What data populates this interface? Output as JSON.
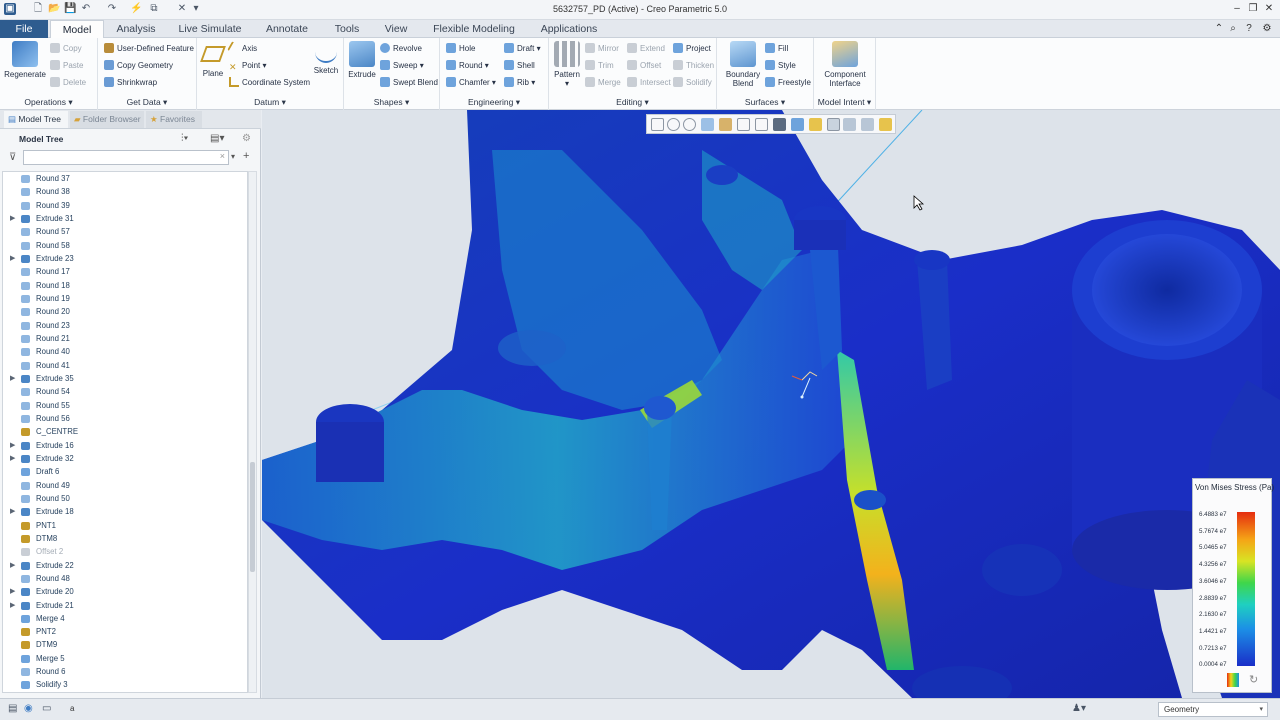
{
  "window": {
    "title": "5632757_PD (Active) - Creo Parametric 5.0"
  },
  "menu_tabs": [
    "File",
    "Model",
    "Analysis",
    "Live Simulate",
    "Annotate",
    "Tools",
    "View",
    "Flexible Modeling",
    "Applications"
  ],
  "ribbon": {
    "operations": {
      "label": "Operations",
      "regenerate": "Regenerate",
      "copy": "Copy",
      "paste": "Paste",
      "delete": "Delete"
    },
    "get_data": {
      "label": "Get Data",
      "udf": "User-Defined Feature",
      "copy_geometry": "Copy Geometry",
      "shrinkwrap": "Shrinkwrap"
    },
    "datum": {
      "label": "Datum",
      "plane": "Plane",
      "axis": "Axis",
      "point": "Point",
      "coord_sys": "Coordinate System",
      "sketch": "Sketch"
    },
    "shapes": {
      "label": "Shapes",
      "extrude": "Extrude",
      "revolve": "Revolve",
      "sweep": "Sweep",
      "swept_blend": "Swept Blend"
    },
    "engineering": {
      "label": "Engineering",
      "hole": "Hole",
      "round": "Round",
      "chamfer": "Chamfer",
      "draft": "Draft",
      "shell": "Shell",
      "rib": "Rib"
    },
    "editing": {
      "label": "Editing",
      "pattern": "Pattern",
      "mirror": "Mirror",
      "trim": "Trim",
      "merge": "Merge",
      "extend": "Extend",
      "offset": "Offset",
      "intersect": "Intersect",
      "project": "Project",
      "thicken": "Thicken",
      "solidify": "Solidify"
    },
    "surfaces": {
      "label": "Surfaces",
      "boundary_blend": "Boundary Blend",
      "fill": "Fill",
      "style": "Style",
      "freestyle": "Freestyle"
    },
    "model_intent": {
      "label": "Model Intent",
      "component_interface": "Component Interface"
    }
  },
  "nav_tabs": [
    "Model Tree",
    "Folder Browser",
    "Favorites"
  ],
  "model_tree": {
    "title": "Model Tree",
    "items": [
      {
        "label": "Round 37",
        "type": "round",
        "expandable": false,
        "dim": false
      },
      {
        "label": "Round 38",
        "type": "round",
        "expandable": false,
        "dim": false
      },
      {
        "label": "Round 39",
        "type": "round",
        "expandable": false,
        "dim": false
      },
      {
        "label": "Extrude 31",
        "type": "extrude",
        "expandable": true,
        "dim": false
      },
      {
        "label": "Round 57",
        "type": "round",
        "expandable": false,
        "dim": false
      },
      {
        "label": "Round 58",
        "type": "round",
        "expandable": false,
        "dim": false
      },
      {
        "label": "Extrude 23",
        "type": "extrude",
        "expandable": true,
        "dim": false
      },
      {
        "label": "Round 17",
        "type": "round",
        "expandable": false,
        "dim": false
      },
      {
        "label": "Round 18",
        "type": "round",
        "expandable": false,
        "dim": false
      },
      {
        "label": "Round 19",
        "type": "round",
        "expandable": false,
        "dim": false
      },
      {
        "label": "Round 20",
        "type": "round",
        "expandable": false,
        "dim": false
      },
      {
        "label": "Round 23",
        "type": "round",
        "expandable": false,
        "dim": false
      },
      {
        "label": "Round 21",
        "type": "round",
        "expandable": false,
        "dim": false
      },
      {
        "label": "Round 40",
        "type": "round",
        "expandable": false,
        "dim": false
      },
      {
        "label": "Round 41",
        "type": "round",
        "expandable": false,
        "dim": false
      },
      {
        "label": "Extrude 35",
        "type": "extrude",
        "expandable": true,
        "dim": false
      },
      {
        "label": "Round 54",
        "type": "round",
        "expandable": false,
        "dim": false
      },
      {
        "label": "Round 55",
        "type": "round",
        "expandable": false,
        "dim": false
      },
      {
        "label": "Round 56",
        "type": "round",
        "expandable": false,
        "dim": false
      },
      {
        "label": "C_CENTRE",
        "type": "datum",
        "expandable": false,
        "dim": false
      },
      {
        "label": "Extrude 16",
        "type": "extrude",
        "expandable": true,
        "dim": false
      },
      {
        "label": "Extrude 32",
        "type": "extrude",
        "expandable": true,
        "dim": false
      },
      {
        "label": "Draft 6",
        "type": "draft",
        "expandable": false,
        "dim": false
      },
      {
        "label": "Round 49",
        "type": "round",
        "expandable": false,
        "dim": false
      },
      {
        "label": "Round 50",
        "type": "round",
        "expandable": false,
        "dim": false
      },
      {
        "label": "Extrude 18",
        "type": "extrude",
        "expandable": true,
        "dim": false
      },
      {
        "label": "PNT1",
        "type": "point",
        "expandable": false,
        "dim": false
      },
      {
        "label": "DTM8",
        "type": "plane",
        "expandable": false,
        "dim": false
      },
      {
        "label": "Offset 2",
        "type": "offset",
        "expandable": false,
        "dim": true
      },
      {
        "label": "Extrude 22",
        "type": "extrude",
        "expandable": true,
        "dim": false
      },
      {
        "label": "Round 48",
        "type": "round",
        "expandable": false,
        "dim": false
      },
      {
        "label": "Extrude 20",
        "type": "extrude",
        "expandable": true,
        "dim": false
      },
      {
        "label": "Extrude 21",
        "type": "extrude",
        "expandable": true,
        "dim": false
      },
      {
        "label": "Merge 4",
        "type": "merge",
        "expandable": false,
        "dim": false
      },
      {
        "label": "PNT2",
        "type": "point",
        "expandable": false,
        "dim": false
      },
      {
        "label": "DTM9",
        "type": "plane",
        "expandable": false,
        "dim": false
      },
      {
        "label": "Merge 5",
        "type": "merge",
        "expandable": false,
        "dim": false
      },
      {
        "label": "Round 6",
        "type": "round",
        "expandable": false,
        "dim": false
      },
      {
        "label": "Solidify 3",
        "type": "solidify",
        "expandable": false,
        "dim": false
      }
    ]
  },
  "legend": {
    "title": "Von Mises Stress (Pa)",
    "values": [
      "6.4883 e7",
      "5.7674 e7",
      "5.0465 e7",
      "4.3256 e7",
      "3.6046 e7",
      "2.8839 e7",
      "2.1630 e7",
      "1.4421 e7",
      "0.7213 e7",
      "0.0004 e7"
    ]
  },
  "status_bar": {
    "text": "a",
    "filter": "Geometry"
  },
  "colors": {
    "accent": "#2e5c8f",
    "stress_high": "#e52d10",
    "stress_low": "#1a2ec8"
  }
}
